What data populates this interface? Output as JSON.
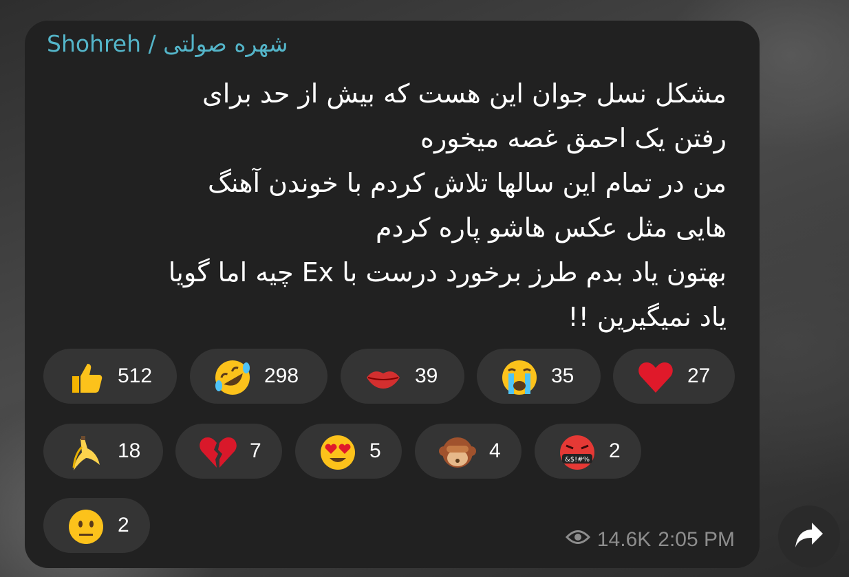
{
  "message": {
    "sender": "Shohreh / شهره صولتی",
    "lines": [
      "مشکل نسل جوان این هست که بیش از حد برای",
      "رفتن یک احمق غصه میخوره",
      "من در تمام این سالها تلاش کردم با خوندن آهنگ",
      "هایی مثل عکس هاشو پاره کردم",
      "بهتون یاد بدم طرز برخورد درست با Ex چیه اما گویا",
      "یاد نمیگیرین !!"
    ],
    "views": "14.6K",
    "time": "2:05 PM"
  },
  "reactions": [
    {
      "emoji": "thumbs-up-icon",
      "count": "512"
    },
    {
      "emoji": "rofl-face-icon",
      "count": "298"
    },
    {
      "emoji": "kiss-lips-icon",
      "count": "39"
    },
    {
      "emoji": "crying-face-icon",
      "count": "35"
    },
    {
      "emoji": "red-heart-icon",
      "count": "27"
    },
    {
      "emoji": "banana-icon",
      "count": "18"
    },
    {
      "emoji": "broken-heart-icon",
      "count": "7"
    },
    {
      "emoji": "heart-eyes-face-icon",
      "count": "5"
    },
    {
      "emoji": "see-no-evil-monkey-icon",
      "count": "4"
    },
    {
      "emoji": "cursing-face-icon",
      "count": "2"
    },
    {
      "emoji": "neutral-face-icon",
      "count": "2"
    }
  ],
  "cursing_symbols": "&$!#%",
  "colors": {
    "sender_name": "#54b5c9",
    "bubble": "#212121",
    "reaction_pill": "#343434",
    "meta_text": "#8d8d8d"
  }
}
